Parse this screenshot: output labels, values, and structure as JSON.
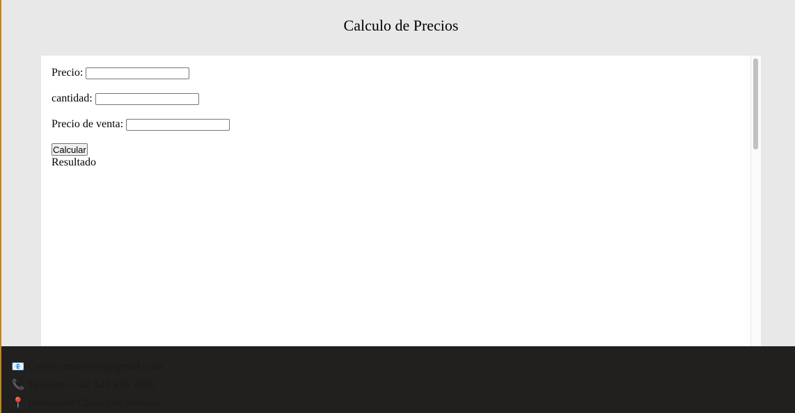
{
  "page": {
    "title": "Calculo de Precios"
  },
  "form": {
    "precio_label": "Precio:",
    "precio_value": "",
    "cantidad_label": "cantidad:",
    "cantidad_value": "",
    "precio_venta_label": "Precio de venta:",
    "precio_venta_value": "",
    "calcular_label": "Calcular",
    "resultado_text": "Resultado"
  },
  "footer": {
    "email": {
      "icon": "envelope-icon",
      "glyph": "📧",
      "text": "Correo: micorreo@gmail.com"
    },
    "phone": {
      "icon": "phone-icon",
      "glyph": "📞",
      "text": "Teléfono: +52 123 456 7890"
    },
    "address": {
      "icon": "pin-icon",
      "glyph": "📍",
      "text": "Dirección: Ciudad de México"
    }
  },
  "colors": {
    "background": "#e8e8e8",
    "content_background": "#ffffff",
    "footer_background": "#221f1f"
  }
}
